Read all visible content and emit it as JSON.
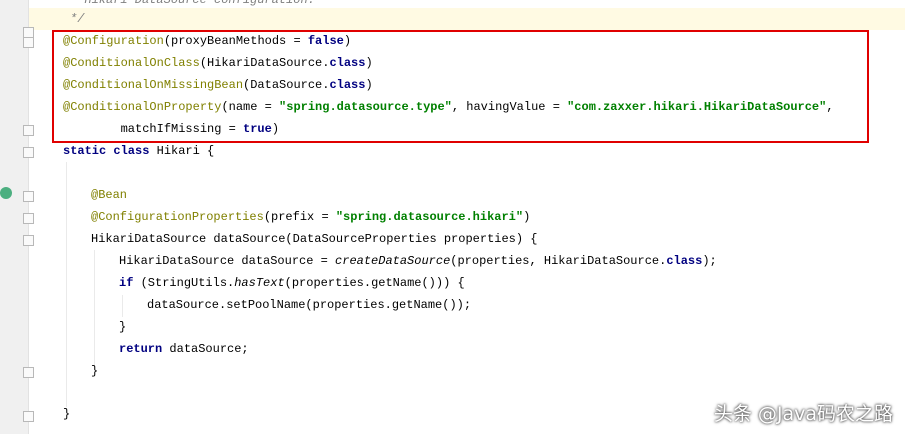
{
  "code": {
    "l0": "* Hikari DataSource configuration.",
    "l1": "*/",
    "l2a": "@Configuration",
    "l2b": "(proxyBeanMethods = ",
    "l2c": "false",
    "l2d": ")",
    "l3a": "@ConditionalOnClass",
    "l3b": "(HikariDataSource.",
    "l3c": "class",
    "l3d": ")",
    "l4a": "@ConditionalOnMissingBean",
    "l4b": "(DataSource.",
    "l4c": "class",
    "l4d": ")",
    "l5a": "@ConditionalOnProperty",
    "l5b": "(name = ",
    "l5c": "\"spring.datasource.type\"",
    "l5d": ", havingValue = ",
    "l5e": "\"com.zaxxer.hikari.HikariDataSource\"",
    "l5f": ",",
    "l6a": "        matchIfMissing = ",
    "l6b": "true",
    "l6c": ")",
    "l7a": "static class ",
    "l7b": "Hikari {",
    "l9": "@Bean",
    "l10a": "@ConfigurationProperties",
    "l10b": "(prefix = ",
    "l10c": "\"spring.datasource.hikari\"",
    "l10d": ")",
    "l11": "HikariDataSource dataSource(DataSourceProperties properties) {",
    "l12a": "HikariDataSource dataSource = ",
    "l12b": "createDataSource",
    "l12c": "(properties, HikariDataSource.",
    "l12d": "class",
    "l12e": ");",
    "l13a": "if ",
    "l13b": "(StringUtils.",
    "l13c": "hasText",
    "l13d": "(properties.getName())) {",
    "l14": "dataSource.setPoolName(properties.getName());",
    "l15": "}",
    "l16a": "return ",
    "l16b": "dataSource;",
    "l17": "}",
    "l19": "}"
  },
  "watermark": "头条 @Java码农之路"
}
